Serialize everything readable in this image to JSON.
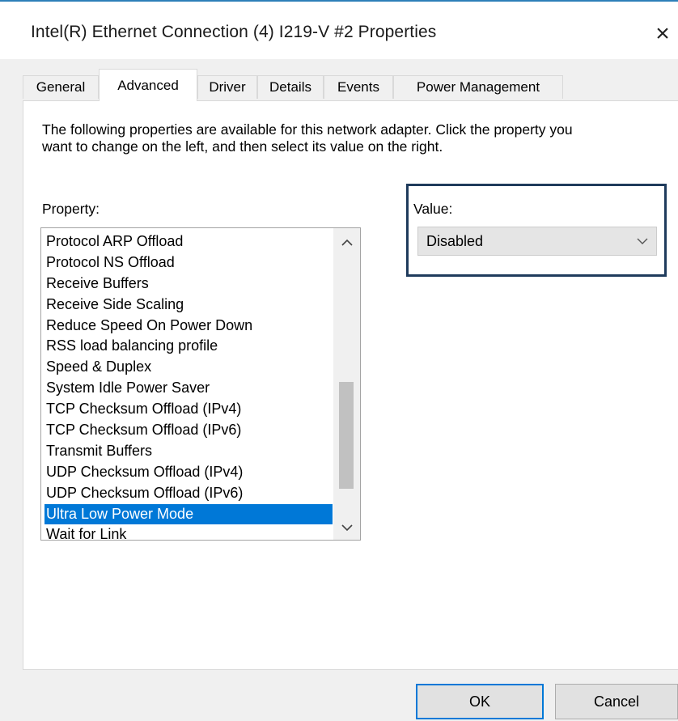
{
  "window": {
    "title": "Intel(R) Ethernet Connection (4) I219-V #2 Properties",
    "close_glyph": "×"
  },
  "tabs": [
    {
      "label": "General",
      "active": false
    },
    {
      "label": "Advanced",
      "active": true
    },
    {
      "label": "Driver",
      "active": false
    },
    {
      "label": "Details",
      "active": false
    },
    {
      "label": "Events",
      "active": false
    },
    {
      "label": "Power Management",
      "active": false
    }
  ],
  "advanced": {
    "description": "The following properties are available for this network adapter. Click the property you want to change on the left, and then select its value on the right.",
    "property_label": "Property:",
    "properties": [
      "Protocol ARP Offload",
      "Protocol NS Offload",
      "Receive Buffers",
      "Receive Side Scaling",
      "Reduce Speed On Power Down",
      "RSS load balancing profile",
      "Speed & Duplex",
      "System Idle Power Saver",
      "TCP Checksum Offload (IPv4)",
      "TCP Checksum Offload (IPv6)",
      "Transmit Buffers",
      "UDP Checksum Offload (IPv4)",
      "UDP Checksum Offload (IPv6)",
      "Ultra Low Power Mode",
      "Wait for Link"
    ],
    "selected_property": "Ultra Low Power Mode",
    "value_label": "Value:",
    "value": "Disabled"
  },
  "buttons": {
    "ok": "OK",
    "cancel": "Cancel"
  },
  "colors": {
    "accent": "#0078d7",
    "highlight_box": "#1f3b5c",
    "dialog_bg": "#f0f0f0"
  },
  "icons": {
    "close": "close-icon",
    "scroll_up": "chevron-up-icon",
    "scroll_down": "chevron-down-icon",
    "dropdown": "chevron-down-icon"
  }
}
